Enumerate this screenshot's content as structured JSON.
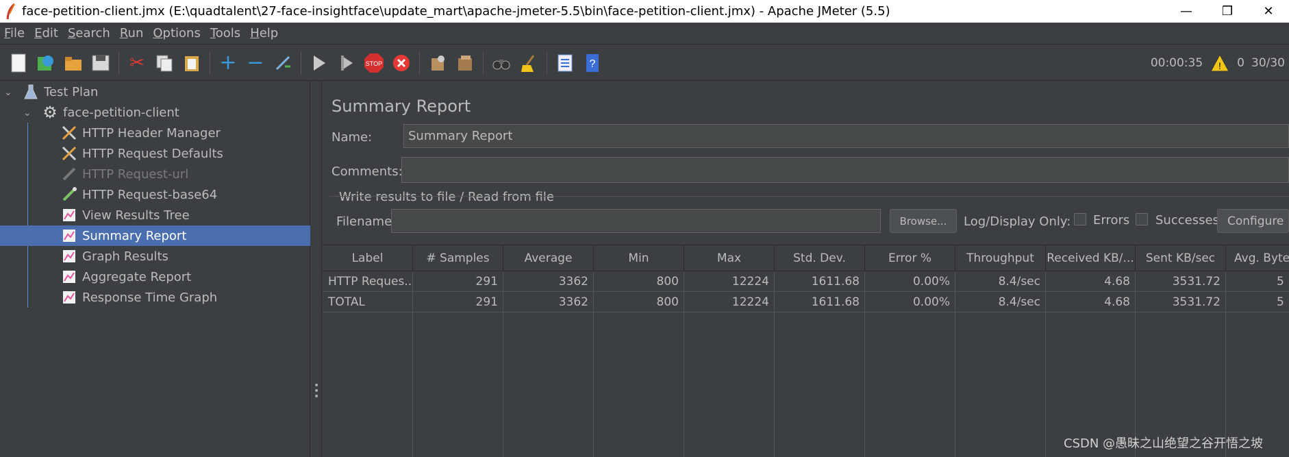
{
  "window": {
    "title": "face-petition-client.jmx (E:\\quadtalent\\27-face-insightface\\update_mart\\apache-jmeter-5.5\\bin\\face-petition-client.jmx) - Apache JMeter (5.5)",
    "minimize": "—",
    "maximize": "❐",
    "close": "✕"
  },
  "menu": [
    {
      "label": "File",
      "mnemonic": "F",
      "rest": "ile"
    },
    {
      "label": "Edit",
      "mnemonic": "E",
      "rest": "dit"
    },
    {
      "label": "Search",
      "mnemonic": "S",
      "rest": "earch"
    },
    {
      "label": "Run",
      "mnemonic": "R",
      "rest": "un"
    },
    {
      "label": "Options",
      "mnemonic": "O",
      "rest": "ptions"
    },
    {
      "label": "Tools",
      "mnemonic": "T",
      "rest": "ools"
    },
    {
      "label": "Help",
      "mnemonic": "H",
      "rest": "elp"
    }
  ],
  "toolbar": {
    "elapsed": "00:00:35",
    "warnings": "0",
    "threads": "30/30"
  },
  "tree": {
    "root": "Test Plan",
    "thread_group": "face-petition-client",
    "items": [
      {
        "label": "HTTP Header Manager",
        "icon": "tools-icon"
      },
      {
        "label": "HTTP Request Defaults",
        "icon": "tools-icon"
      },
      {
        "label": "HTTP Request-url",
        "icon": "pipette-icon",
        "disabled": true
      },
      {
        "label": "HTTP Request-base64",
        "icon": "pipette-icon"
      },
      {
        "label": "View Results Tree",
        "icon": "chart-icon"
      },
      {
        "label": "Summary Report",
        "icon": "chart-icon",
        "selected": true
      },
      {
        "label": "Graph Results",
        "icon": "chart-icon"
      },
      {
        "label": "Aggregate Report",
        "icon": "chart-icon"
      },
      {
        "label": "Response Time Graph",
        "icon": "chart-icon"
      }
    ]
  },
  "panel": {
    "heading": "Summary Report",
    "name_label": "Name:",
    "name_value": "Summary Report",
    "comments_label": "Comments:",
    "comments_value": "",
    "file_section": "Write results to file / Read from file",
    "filename_label": "Filename",
    "filename_value": "",
    "browse": "Browse...",
    "log_display": "Log/Display Only:",
    "errors": "Errors",
    "successes": "Successes",
    "configure": "Configure"
  },
  "table": {
    "columns": [
      "Label",
      "# Samples",
      "Average",
      "Min",
      "Max",
      "Std. Dev.",
      "Error %",
      "Throughput",
      "Received KB/...",
      "Sent KB/sec",
      "Avg. Byte"
    ],
    "rows": [
      [
        "HTTP Reques...",
        "291",
        "3362",
        "800",
        "12224",
        "1611.68",
        "0.00%",
        "8.4/sec",
        "4.68",
        "3531.72",
        "5"
      ],
      [
        "TOTAL",
        "291",
        "3362",
        "800",
        "12224",
        "1611.68",
        "0.00%",
        "8.4/sec",
        "4.68",
        "3531.72",
        "5"
      ]
    ]
  },
  "watermark": "CSDN @愚昧之山绝望之谷开悟之坡"
}
